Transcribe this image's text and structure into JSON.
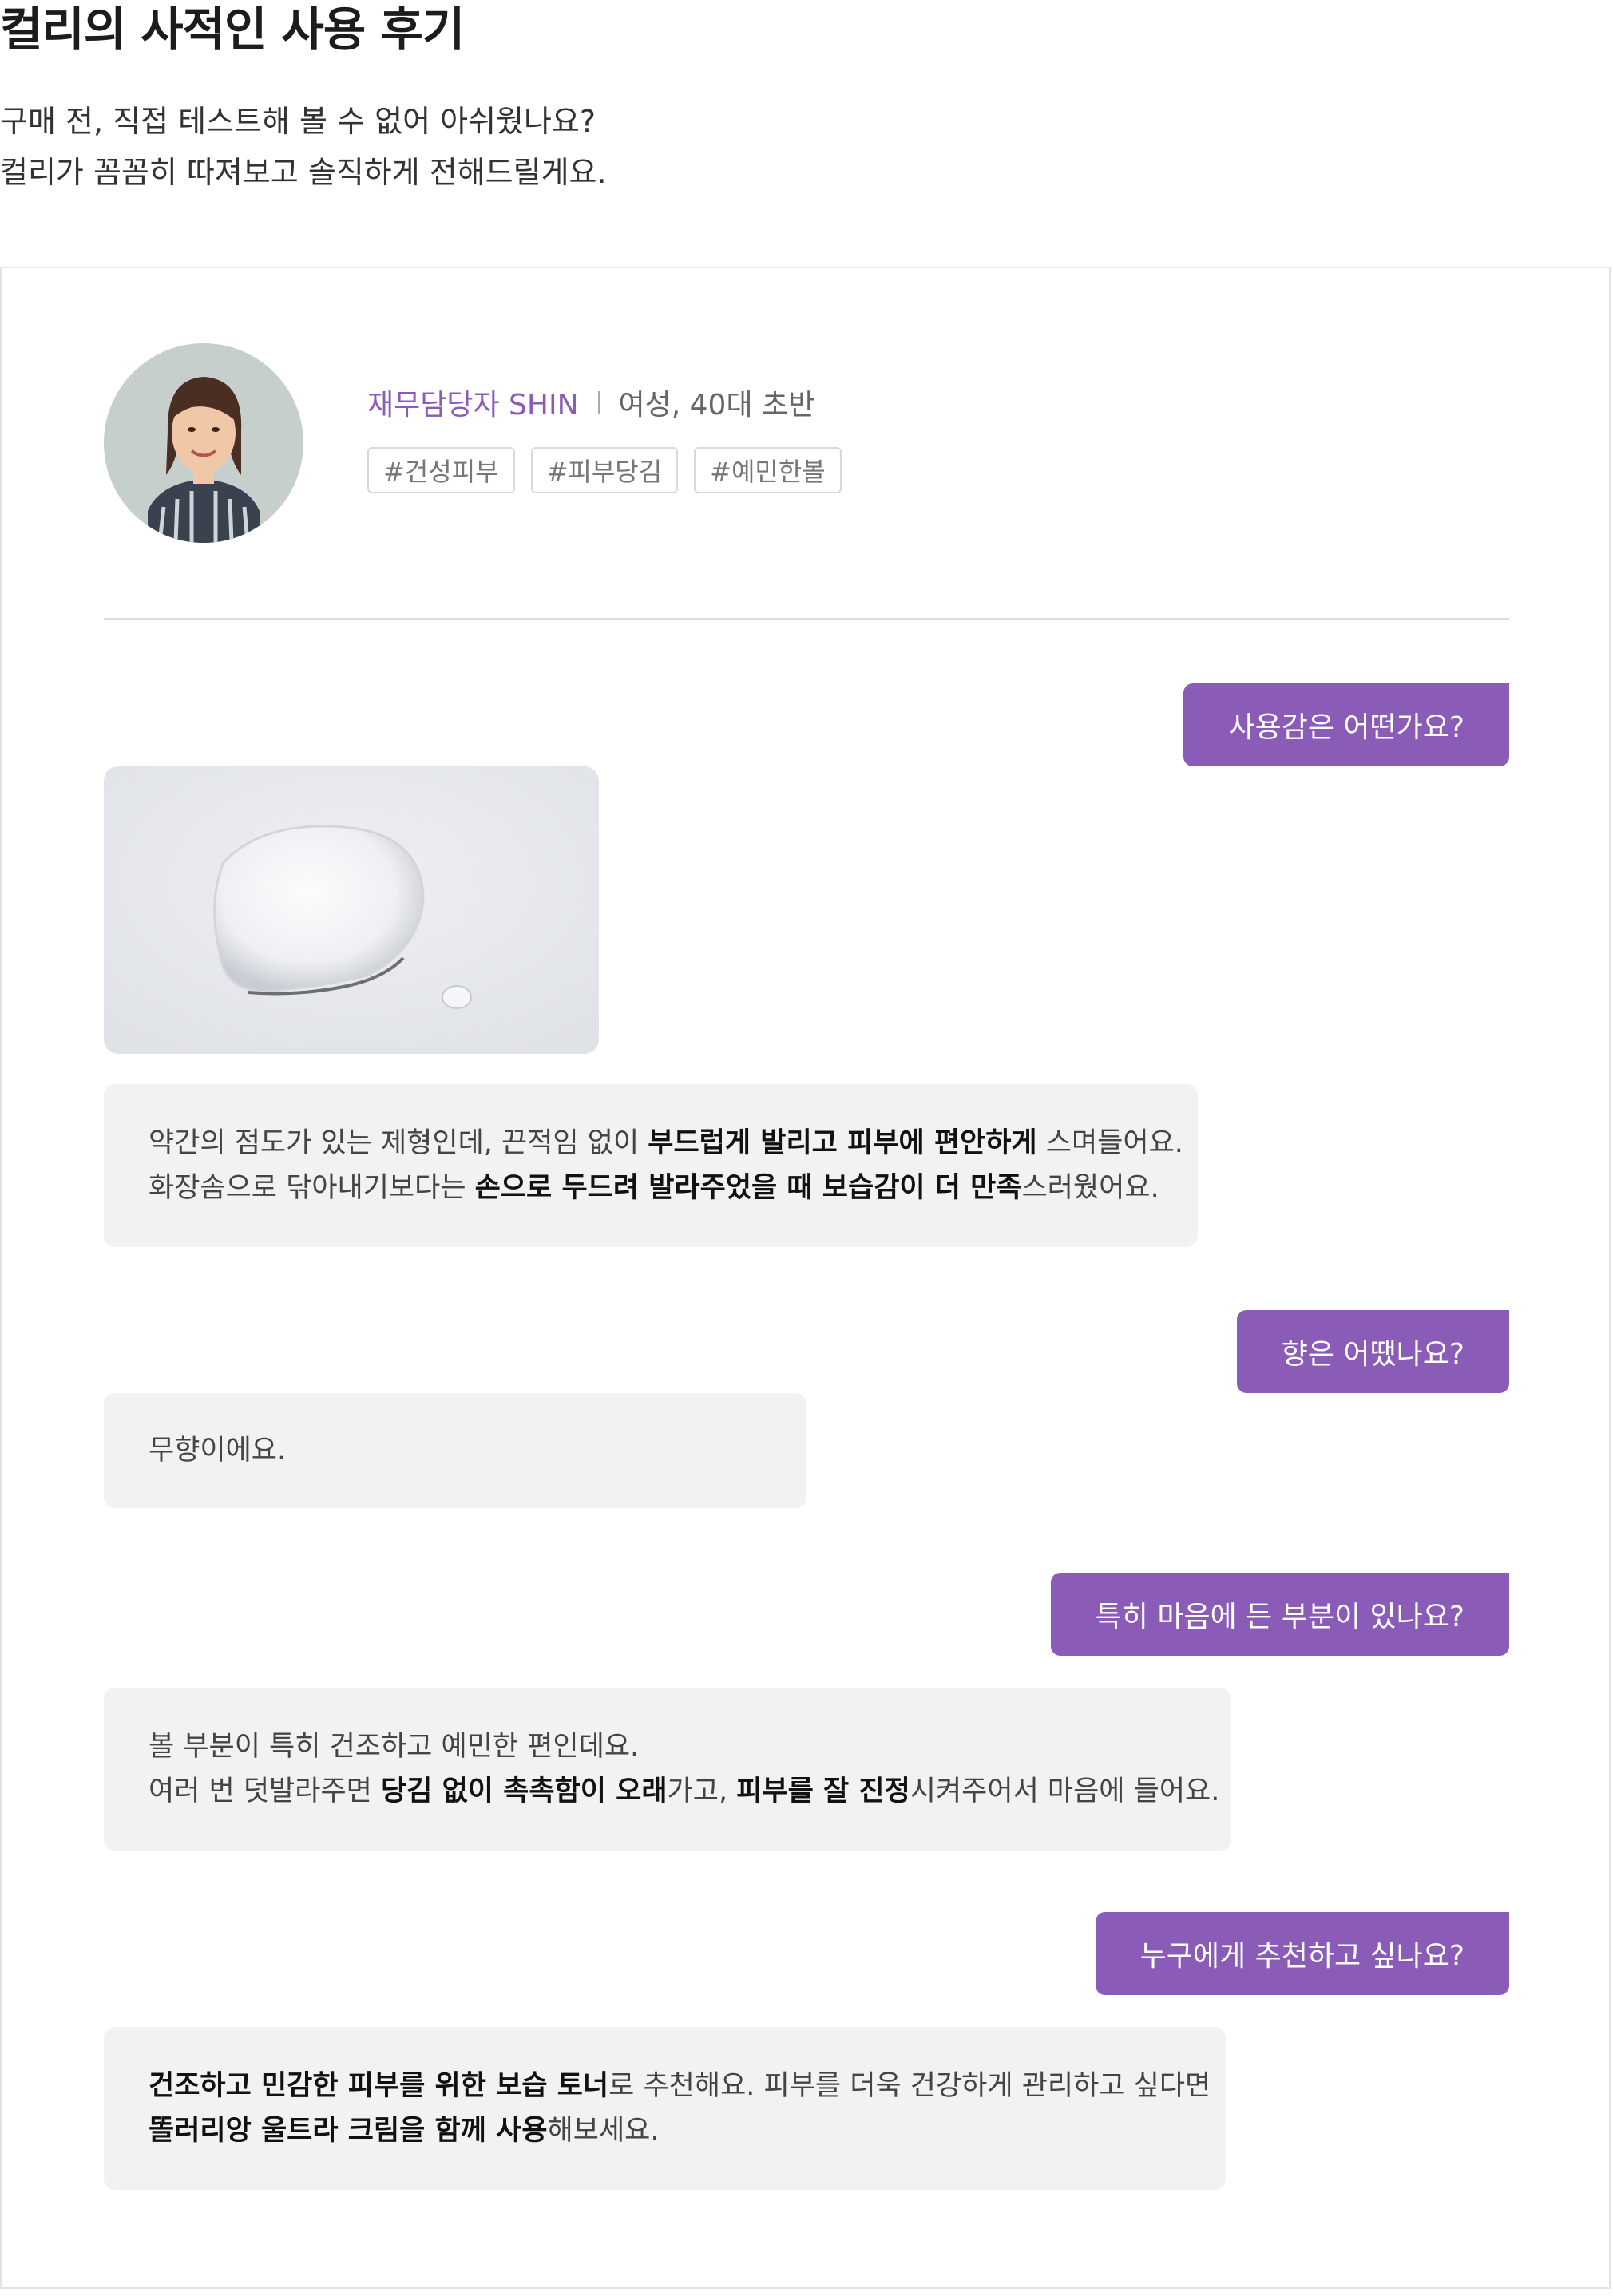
{
  "page": {
    "title": "컬리의 사적인 사용 후기",
    "intro_line1": "구매 전, 직접 테스트해 볼 수 없어 아쉬웠나요?",
    "intro_line2": "컬리가 꼼꼼히 따져보고 솔직하게 전해드릴게요."
  },
  "reviewer": {
    "name": "재무담당자 SHIN",
    "meta": "여성, 40대 초반",
    "tags": [
      "#건성피부",
      "#피부당김",
      "#예민한볼"
    ]
  },
  "chat": {
    "q1": "사용감은 어떤가요?",
    "a1": {
      "l1_p1": "약간의 점도가 있는 제형인데, 끈적임 없이 ",
      "l1_b1": "부드럽게 발리고 피부에 편안하게",
      "l1_p2": " 스며들어요.",
      "l2_p1": "화장솜으로 닦아내기보다는 ",
      "l2_b1": "손으로 두드려 발라주었을 때 보습감이 더 만족",
      "l2_p2": "스러웠어요."
    },
    "q2": "향은 어땠나요?",
    "a2": "무향이에요.",
    "q3": "특히 마음에 든 부분이 있나요?",
    "a3": {
      "l1": "볼 부분이 특히 건조하고 예민한 편인데요.",
      "l2_p1": "여러 번 덧발라주면 ",
      "l2_b1": "당김 없이 촉촉함이 오래",
      "l2_p2": "가고, ",
      "l2_b2": "피부를 잘 진정",
      "l2_p3": "시켜주어서 마음에 들어요."
    },
    "q4": "누구에게 추천하고 싶나요?",
    "a4": {
      "l1_b1": "건조하고 민감한 피부를 위한 보습 토너",
      "l1_p1": "로 추천해요. 피부를 더욱 건강하게 관리하고 싶다면",
      "l2_b1": "똘러리앙 울트라 크림을 함께 사용",
      "l2_p1": "해보세요."
    }
  },
  "colors": {
    "accent": "#8a5cb8",
    "bubble_bg": "#f2f2f2"
  }
}
